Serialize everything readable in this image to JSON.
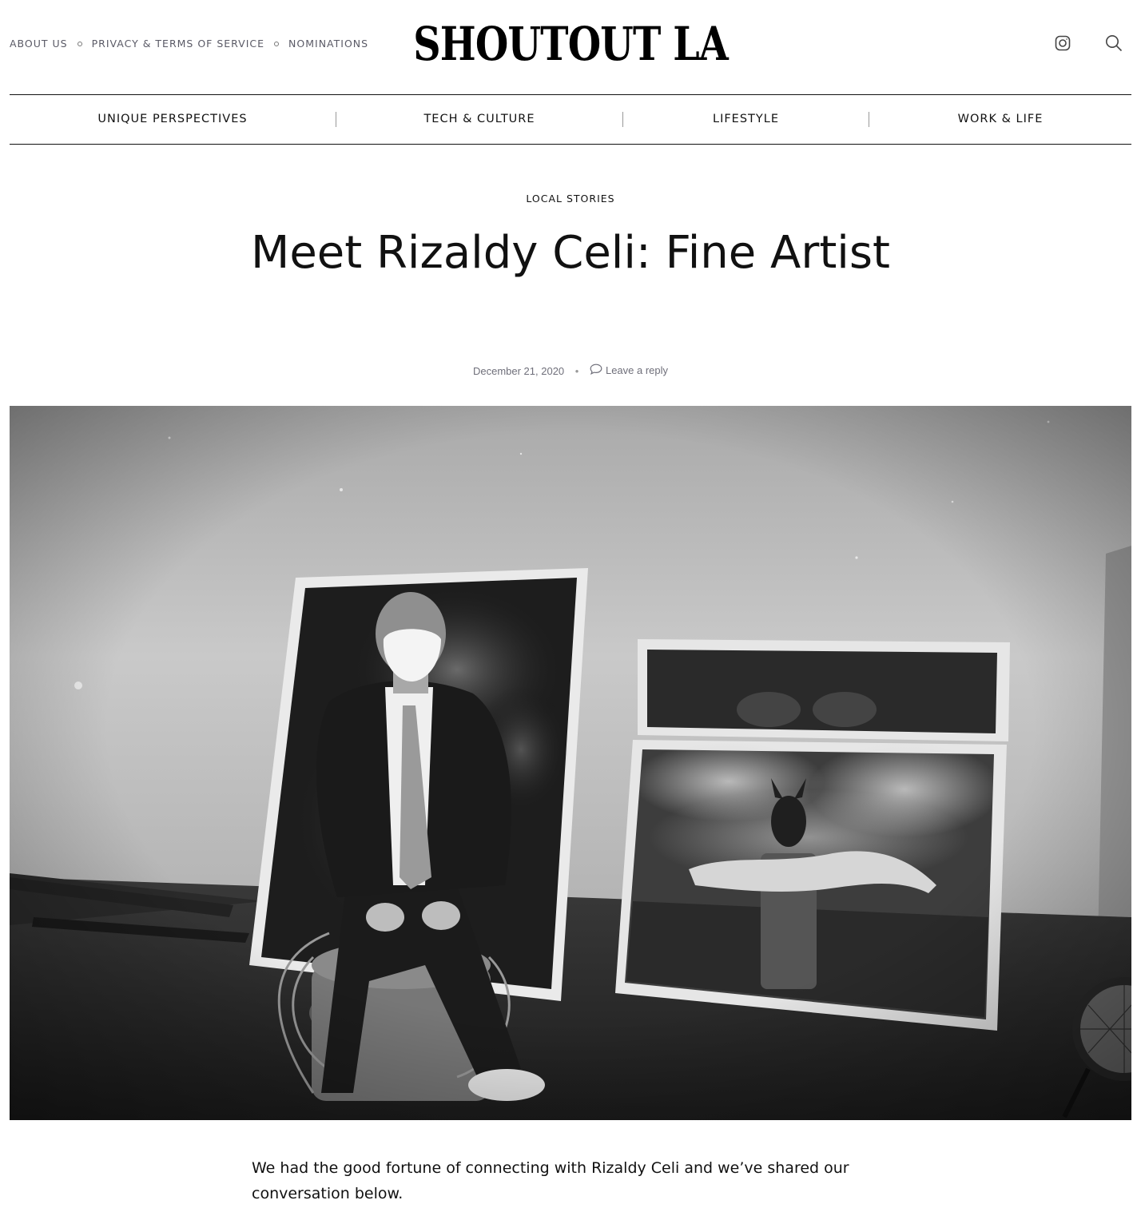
{
  "header": {
    "links": [
      "ABOUT US",
      "PRIVACY & TERMS OF SERVICE",
      "NOMINATIONS"
    ],
    "logo": "SHOUTOUT LA",
    "icons": [
      "instagram-icon",
      "search-icon"
    ]
  },
  "nav": {
    "items": [
      "UNIQUE PERSPECTIVES",
      "TECH & CULTURE",
      "LIFESTYLE",
      "WORK & LIFE"
    ]
  },
  "article": {
    "category": "LOCAL STORIES",
    "title": "Meet Rizaldy Celi: Fine Artist",
    "date": "December 21, 2020",
    "separator": "•",
    "reply_label": "Leave a reply",
    "intro": "We had the good fortune of connecting with Rizaldy Celi and we’ve shared our conversation below."
  },
  "colors": {
    "text": "#111111",
    "muted": "#6f6f7a",
    "link_muted": "#5a5a66",
    "background": "#ffffff"
  }
}
